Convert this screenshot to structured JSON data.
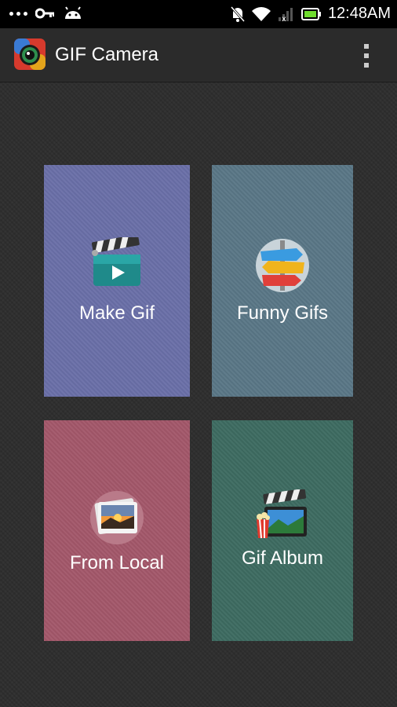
{
  "status_bar": {
    "time": "12:48AM",
    "icons": [
      "dots-icon",
      "key-icon",
      "android-icon",
      "muted-bell-icon",
      "wifi-icon",
      "signal-icon",
      "battery-icon"
    ]
  },
  "action_bar": {
    "title": "GIF Camera",
    "app_icon": "gif-camera-app-icon",
    "menu_icon": "overflow-menu-icon"
  },
  "tiles": [
    {
      "label": "Make Gif",
      "icon": "clapperboard-play-icon",
      "color": "#6a6fa8"
    },
    {
      "label": "Funny Gifs",
      "icon": "signpost-icon",
      "color": "#5a7786"
    },
    {
      "label": "From Local",
      "icon": "photo-stack-icon",
      "color": "#a3576a"
    },
    {
      "label": "Gif Album",
      "icon": "movie-album-icon",
      "color": "#3d6b61"
    }
  ]
}
